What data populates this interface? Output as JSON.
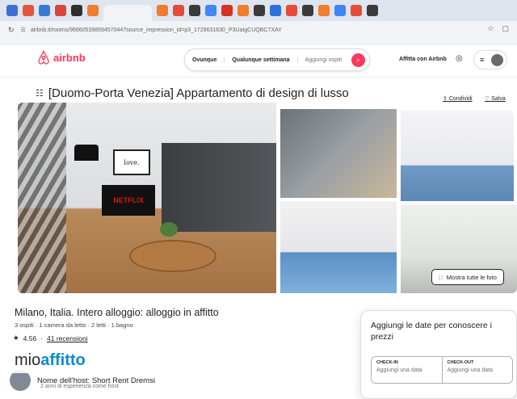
{
  "browser": {
    "url": "airbnb.it/rooms/966605398594570447source_impression_id=p3_1729631630_P3UaIgCUQBC7XAY"
  },
  "header": {
    "logo_text": "airbnb",
    "search": {
      "where": "Ovunque",
      "when": "Qualunque settimana",
      "guests": "Aggiungi ospiti"
    },
    "host_link": "Affitta con Airbnb"
  },
  "listing": {
    "title": "[Duomo-Porta Venezia] Appartamento di design di lusso",
    "share_label": "Condividi",
    "save_label": "Salva",
    "show_all_photos": "Mostra tutte le foto",
    "photo_text": {
      "tv": "NETFLIX",
      "frame": "love."
    },
    "location_title": "Milano, Italia. Intero alloggio: alloggio in affitto",
    "details": "3 ospiti · 1 camera da letto · 2 letti · 1 bagno",
    "rating": "4.56",
    "reviews": "41 recensioni"
  },
  "booking": {
    "title": "Aggiungi le date per conoscere i prezzi",
    "checkin_label": "CHECK-IN",
    "checkin_value": "Aggiungi una data",
    "checkout_label": "CHECK-OUT",
    "checkout_value": "Aggiungi una data"
  },
  "host": {
    "name": "Nome dell'host: Short Rent Dremsi",
    "sub": "2 anni di esperienza come host"
  },
  "watermark": {
    "part1": "mio",
    "part2": "affitto"
  },
  "colors": {
    "brand": "#ff385c",
    "watermark_accent": "#0a8ad6"
  }
}
